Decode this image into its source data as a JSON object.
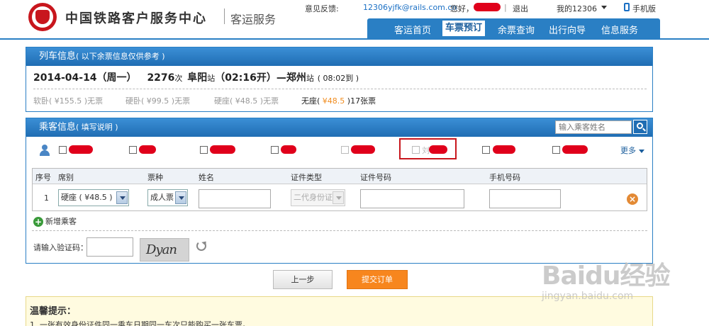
{
  "header": {
    "site_name": "中国铁路客户服务中心",
    "site_sub": "客运服务",
    "feedback_label": "意见反馈:",
    "feedback_email": "12306yjfk@rails.com.cn",
    "greeting": "您好，",
    "logout": "退出",
    "my_account": "我的12306",
    "mobile": "手机版"
  },
  "nav": {
    "items": [
      "客运首页",
      "车票预订",
      "余票查询",
      "出行向导",
      "信息服务"
    ],
    "active": "车票预订"
  },
  "train_panel": {
    "title": "列车信息",
    "title_note": "( 以下余票信息仅供参考 )",
    "date": "2014-04-14（周一）",
    "train_no": "2276",
    "train_suffix": "次",
    "from": "阜阳",
    "station_suffix": "站",
    "depart": "（02:16开）",
    "dash": "—",
    "to": "郑州",
    "arrive": "( 08:02到 )",
    "seats": [
      {
        "name": "软卧",
        "price_open": "( ",
        "price": "¥155.5",
        "price_close": " )",
        "status": "无票",
        "available": false
      },
      {
        "name": "硬卧",
        "price_open": "( ",
        "price": "¥99.5",
        "price_close": " )",
        "status": "无票",
        "available": false
      },
      {
        "name": "硬座",
        "price_open": "( ",
        "price": "¥48.5",
        "price_close": " )",
        "status": "无票",
        "available": false
      },
      {
        "name": "无座",
        "price_open": "( ",
        "price": "¥48.5",
        "price_close": " )",
        "status": "17张票",
        "available": true
      }
    ]
  },
  "passenger_panel": {
    "title": "乘客信息",
    "title_note": "( 填写说明 )",
    "search_placeholder": "输入乘客姓名",
    "highlight_prefix": "刘",
    "more": "更多",
    "table_headers": [
      "序号",
      "席别",
      "票种",
      "姓名",
      "证件类型",
      "证件号码",
      "手机号码"
    ],
    "row": {
      "index": "1",
      "seat": "硬座 ( ¥48.5 )",
      "ticket_type": "成人票",
      "id_type": "二代身份证"
    },
    "add_passenger": "新增乘客",
    "captcha_label": "请输入验证码：",
    "captcha_text": "Dyan"
  },
  "actions": {
    "prev": "上一步",
    "submit": "提交订单"
  },
  "tips": {
    "title": "温馨提示：",
    "line1": "1. 一张有效身份证件同一乘车日期同一车次只能购买一张车票。"
  },
  "watermark": {
    "brand": "Baidu经验",
    "url": "jingyan.baidu.com"
  },
  "colors": {
    "brand_red": "#c8161d",
    "nav_blue": "#2a7fc4",
    "price_orange": "#f08c1e",
    "submit_orange": "#f7861e"
  }
}
